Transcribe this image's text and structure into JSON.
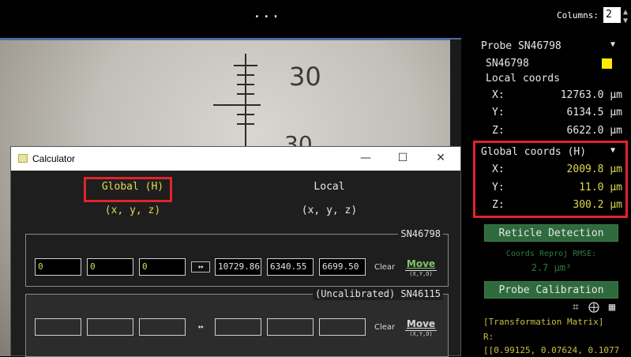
{
  "topbar": {
    "dots": "...",
    "columns_label": "Columns:",
    "columns_value": "2"
  },
  "view": {
    "ruler_numbers": [
      "30",
      "30"
    ]
  },
  "calculator": {
    "title": "Calculator",
    "global_header": "Global (H)",
    "global_sub": "(x, y, z)",
    "local_header": "Local",
    "local_sub": "(x, y, z)",
    "probes": [
      {
        "label": "SN46798",
        "global": [
          "0",
          "0",
          "0"
        ],
        "local": [
          "10729.86",
          "6340.55",
          "6699.50"
        ],
        "swap": "↔",
        "clear": "Clear",
        "move": "Move",
        "move_sub": "(X,Y,O)"
      },
      {
        "label": "(Uncalibrated) SN46115",
        "global": [
          "",
          "",
          ""
        ],
        "local": [
          "",
          "",
          ""
        ],
        "swap": "↔",
        "clear": "Clear",
        "move": "Move",
        "move_sub": "(X,Y,O)"
      }
    ]
  },
  "panel": {
    "probe_select": "Probe SN46798",
    "probe_name": "SN46798",
    "local_coords_label": "Local coords",
    "local": [
      {
        "axis": "X:",
        "value": "12763.0 µm"
      },
      {
        "axis": "Y:",
        "value": "6134.5 µm"
      },
      {
        "axis": "Z:",
        "value": "6622.0 µm"
      }
    ],
    "global_coords_label": "Global coords (H)",
    "global": [
      {
        "axis": "X:",
        "value": "2009.8 µm"
      },
      {
        "axis": "Y:",
        "value": "11.0 µm"
      },
      {
        "axis": "Z:",
        "value": "300.2 µm"
      }
    ],
    "reticle_button": "Reticle Detection",
    "rmse_label": "Coords Reproj RMSE:",
    "rmse_value": "2.7 µm³",
    "probe_calibration_button": "Probe Calibration",
    "tm_label": "[Transformation Matrix]",
    "tm_r": "R:",
    "tm_row": "[[0.99125, 0.07624, 0.1077"
  },
  "colors": {
    "highlight": "#e0242c",
    "accent_yellow": "#e0d94e",
    "button_green": "#2f6a3c"
  }
}
